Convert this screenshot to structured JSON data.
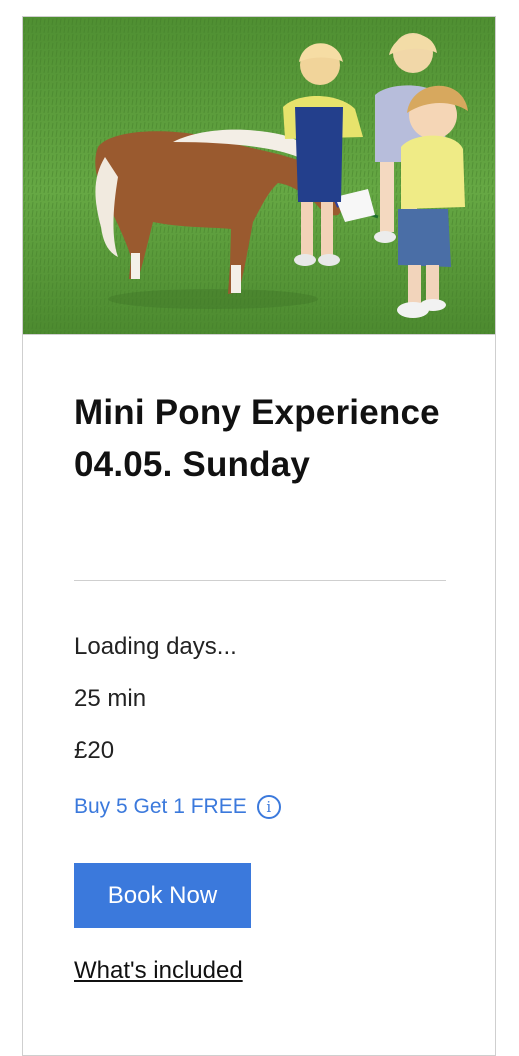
{
  "service": {
    "title": "Mini Pony Experience 04.05. Sunday",
    "days_status": "Loading days...",
    "duration": "25 min",
    "price": "£20",
    "promo": "Buy 5 Get 1 FREE",
    "book_button": "Book Now",
    "included_link": "What's included"
  },
  "colors": {
    "accent": "#3b79dc",
    "text": "#111111",
    "divider": "#cfcfcf"
  },
  "icons": {
    "promo_info": "info-icon"
  }
}
